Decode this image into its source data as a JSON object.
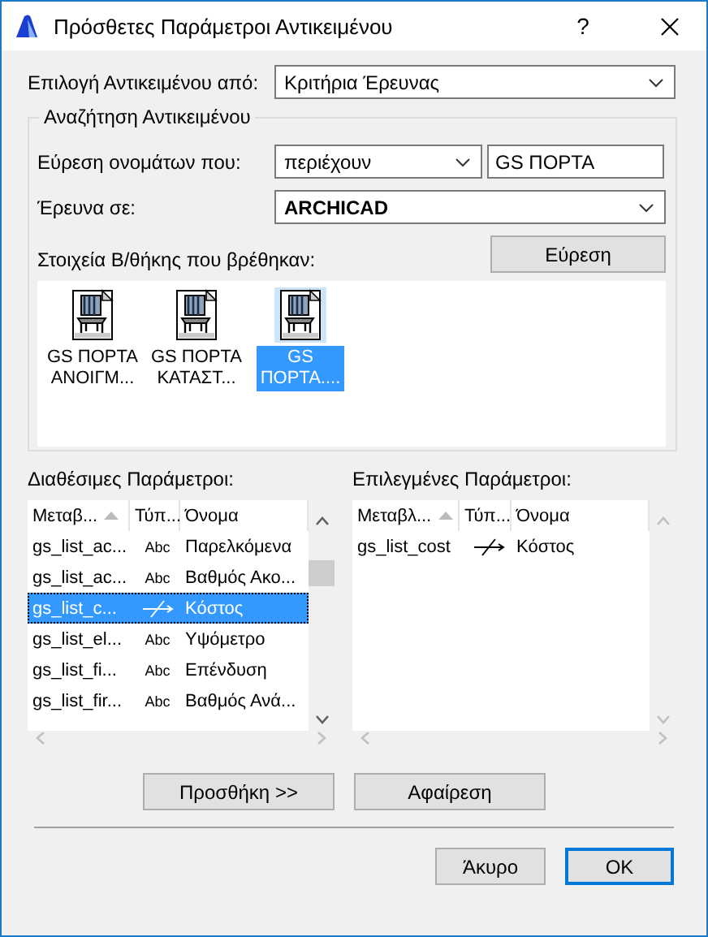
{
  "window": {
    "title": "Πρόσθετες Παράμετροι Αντικειμένου",
    "help": "?"
  },
  "select_from": {
    "label": "Επιλογή Αντικειμένου από:",
    "value": "Κριτήρια Έρευνας"
  },
  "search_group": {
    "title": "Αναζήτηση Αντικειμένου",
    "find_names": {
      "label": "Εύρεση ονομάτων που:",
      "condition": "περιέχουν",
      "value": "GS ΠΟΡΤΑ"
    },
    "search_in": {
      "label": "Έρευνα σε:",
      "value": "ARCHICAD"
    },
    "find_button": "Εύρεση",
    "found_label": "Στοιχεία Β/θήκης που βρέθηκαν:",
    "found_items": [
      {
        "label": "GS ΠΟΡΤΑ\nΑΝΟΙΓΜ...",
        "selected": false
      },
      {
        "label": "GS ΠΟΡΤΑ\nΚΑΤΑΣΤ...",
        "selected": false
      },
      {
        "label": "GS\nΠΟΡΤΑ....",
        "selected": true
      }
    ]
  },
  "available": {
    "label": "Διαθέσιμες Παράμετροι:",
    "columns": [
      "Μεταβ...",
      "Τύπ...",
      "Όνομα"
    ],
    "rows": [
      {
        "variable": "gs_list_ac...",
        "kind": "text",
        "type": "Abc",
        "name": "Παρελκόμενα",
        "selected": false
      },
      {
        "variable": "gs_list_ac...",
        "kind": "text",
        "type": "Abc",
        "name": "Βαθμός Ακο...",
        "selected": false
      },
      {
        "variable": "gs_list_c...",
        "kind": "real",
        "name": "Κόστος",
        "selected": true
      },
      {
        "variable": "gs_list_el...",
        "kind": "text",
        "type": "Abc",
        "name": "Υψόμετρο",
        "selected": false
      },
      {
        "variable": "gs_list_fi...",
        "kind": "text",
        "type": "Abc",
        "name": "Επένδυση",
        "selected": false
      },
      {
        "variable": "gs_list_fir...",
        "kind": "text",
        "type": "Abc",
        "name": "Βαθμός Ανά...",
        "selected": false
      }
    ]
  },
  "chosen": {
    "label": "Επιλεγμένες Παράμετροι:",
    "columns": [
      "Μεταβλ...",
      "Τύπ...",
      "Όνομα"
    ],
    "rows": [
      {
        "variable": "gs_list_cost",
        "kind": "real",
        "name": "Κόστος",
        "selected": false
      }
    ]
  },
  "add_button": "Προσθήκη >>",
  "remove_button": "Αφαίρεση",
  "buttons": [
    {
      "label": "Άκυρο",
      "default": false
    },
    {
      "label": "OK",
      "default": true
    }
  ]
}
